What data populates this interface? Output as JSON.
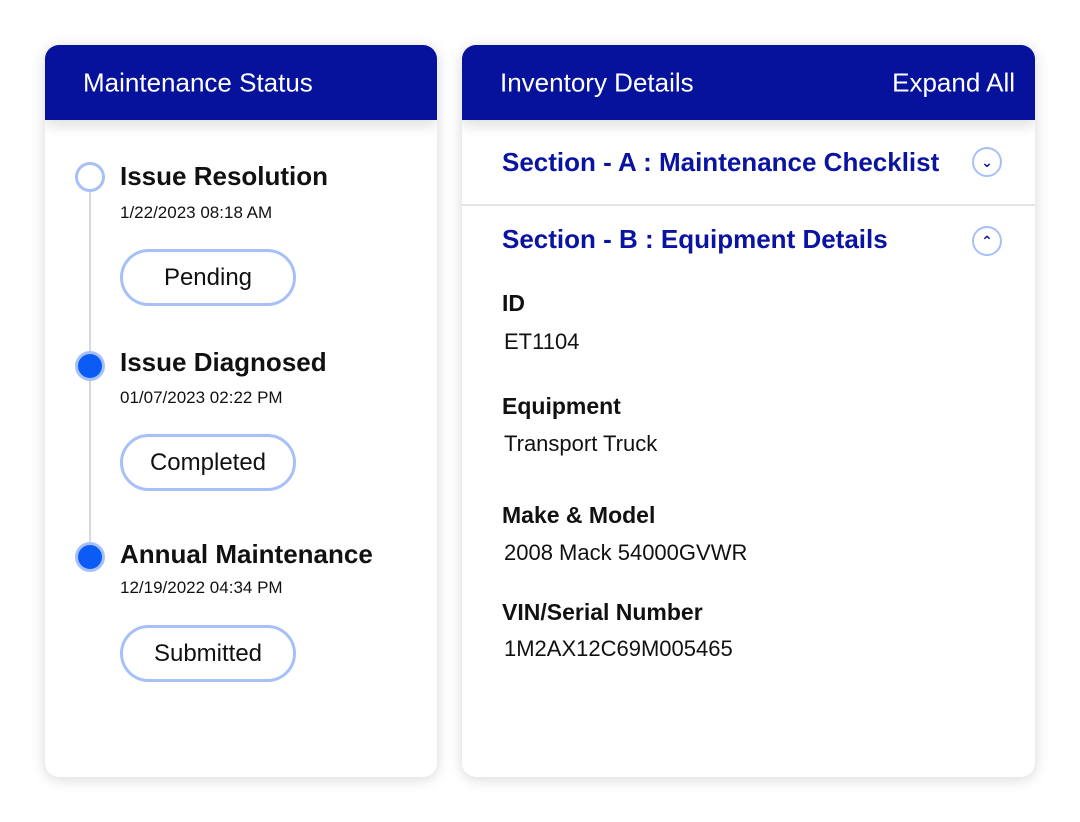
{
  "maintenance": {
    "title": "Maintenance Status",
    "items": [
      {
        "title": "Issue Resolution",
        "datetime": "1/22/2023  08:18 AM",
        "status": "Pending",
        "completed": false
      },
      {
        "title": "Issue Diagnosed",
        "datetime": "01/07/2023  02:22 PM",
        "status": "Completed",
        "completed": true
      },
      {
        "title": "Annual Maintenance",
        "datetime": "12/19/2022  04:34 PM",
        "status": "Submitted",
        "completed": true
      }
    ]
  },
  "inventory": {
    "title": "Inventory Details",
    "expand_all": "Expand All",
    "sections": [
      {
        "title": "Section - A : Maintenance Checklist",
        "icon": "chevron-down-icon",
        "expanded": false
      },
      {
        "title": "Section - B : Equipment Details",
        "icon": "chevron-up-icon",
        "expanded": true
      }
    ],
    "fields": [
      {
        "label": "ID",
        "value": "ET1104"
      },
      {
        "label": "Equipment",
        "value": "Transport Truck"
      },
      {
        "label": "Make & Model",
        "value": "2008 Mack 54000GVWR"
      },
      {
        "label": "VIN/Serial Number",
        "value": "1M2AX12C69M005465"
      }
    ]
  },
  "colors": {
    "header": "#06129c",
    "accent": "#0a5cf5",
    "outline": "#a8c0f8"
  }
}
